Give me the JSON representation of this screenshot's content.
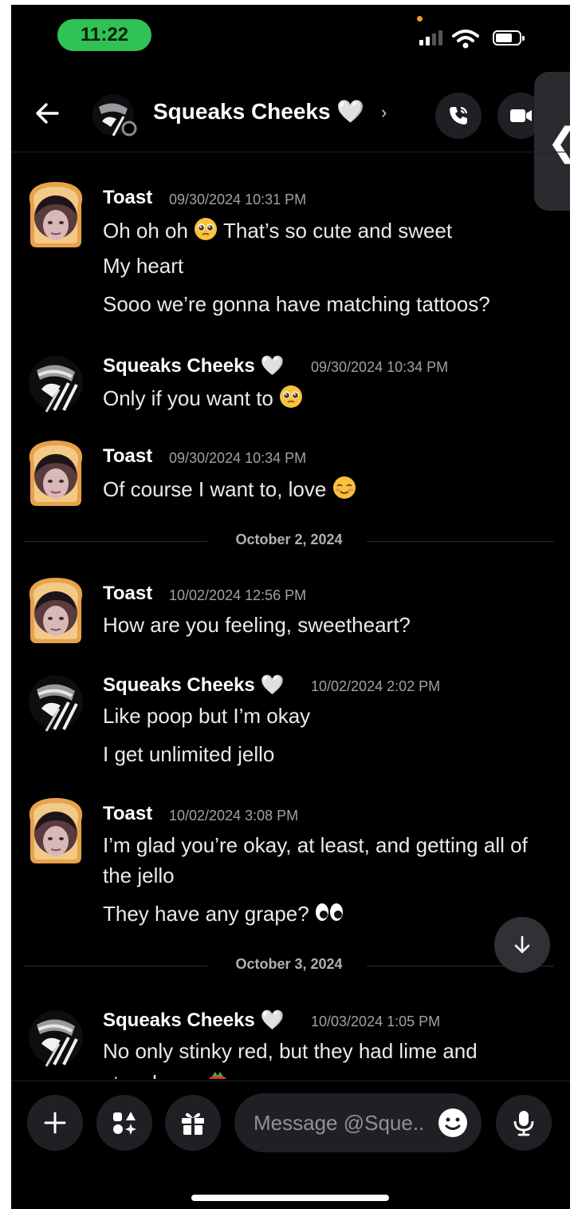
{
  "status_bar": {
    "time": "11:22"
  },
  "header": {
    "title": "Squeaks Cheeks 🤍",
    "chevron": "›",
    "handle": "❮"
  },
  "composer": {
    "placeholder": "Message @Sque..."
  },
  "dates": {
    "oct2": "October 2, 2024",
    "oct3": "October 3, 2024"
  },
  "groups": [
    {
      "author": "Toast",
      "timestamp": "09/30/2024 10:31 PM",
      "lines": [
        "Oh oh oh",
        "That’s so cute and sweet",
        "My heart",
        "Sooo we’re gonna have matching tattoos?"
      ]
    },
    {
      "author": "Squeaks Cheeks 🤍",
      "timestamp": "09/30/2024 10:34 PM",
      "lines": [
        "Only if you want to"
      ]
    },
    {
      "author": "Toast",
      "timestamp": "09/30/2024 10:34 PM",
      "lines": [
        "Of course I want to, love"
      ]
    },
    {
      "author": "Toast",
      "timestamp": "10/02/2024 12:56 PM",
      "lines": [
        "How are you feeling, sweetheart?"
      ]
    },
    {
      "author": "Squeaks Cheeks 🤍",
      "timestamp": "10/02/2024 2:02 PM",
      "lines": [
        "Like poop but I’m okay",
        "I get unlimited jello"
      ]
    },
    {
      "author": "Toast",
      "timestamp": "10/02/2024 3:08 PM",
      "lines": [
        "I’m glad you’re okay, at least, and getting all of",
        "the jello",
        "They have any grape?"
      ]
    },
    {
      "author": "Squeaks Cheeks 🤍",
      "timestamp": "10/03/2024 1:05 PM",
      "lines": [
        "No only stinky red, but they had lime and",
        "strawberry"
      ]
    }
  ],
  "colors": {
    "background": "#000000",
    "status_time_pill": "#30c254",
    "muted_text": "#9ea1a8",
    "surface": "#1f2024"
  },
  "icons": [
    "back-arrow-icon",
    "voice-call-icon",
    "video-call-icon",
    "arrow-down-icon",
    "plus-icon",
    "apps-icon",
    "gift-icon",
    "emoji-icon",
    "microphone-icon"
  ]
}
